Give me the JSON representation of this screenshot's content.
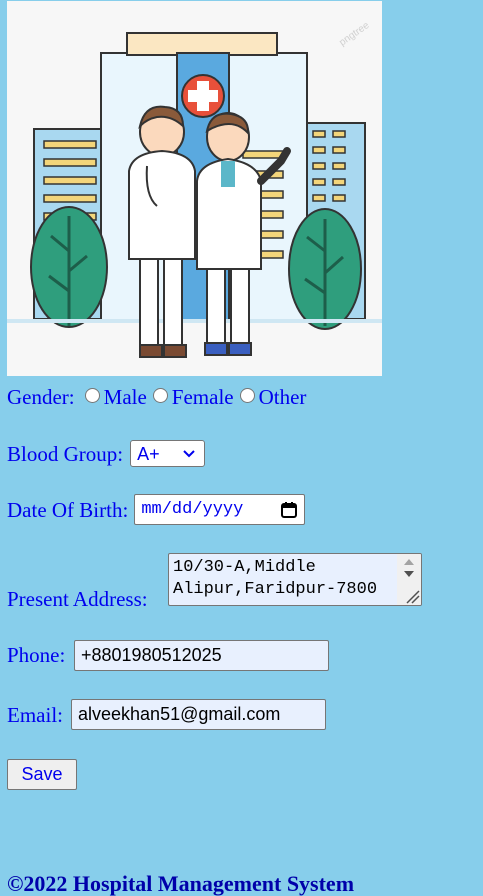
{
  "form": {
    "gender_label": "Gender:",
    "gender_options": [
      "Male",
      "Female",
      "Other"
    ],
    "blood_group_label": "Blood Group:",
    "blood_group_value": "A+",
    "dob_label": "Date Of Birth:",
    "dob_placeholder": "mm/dd/yyyy",
    "address_label": "Present Address:",
    "address_line1": "10/30-A,Middle",
    "address_line2": "Alipur,Faridpur-7800",
    "phone_label": "Phone:",
    "phone_value": "+8801980512025",
    "email_label": "Email:",
    "email_value": "alveekhan51@gmail.com",
    "save_label": "Save"
  },
  "hero": {
    "watermark": "pngtree"
  },
  "footer": {
    "text": "©2022 Hospital Management System"
  },
  "colors": {
    "background": "#87ceeb",
    "text": "#0000ee",
    "footer_text": "#0000aa",
    "autofill": "#e8f0fe"
  },
  "icons": [
    "hospital-cross-icon",
    "calendar-icon",
    "chevron-down-icon"
  ]
}
